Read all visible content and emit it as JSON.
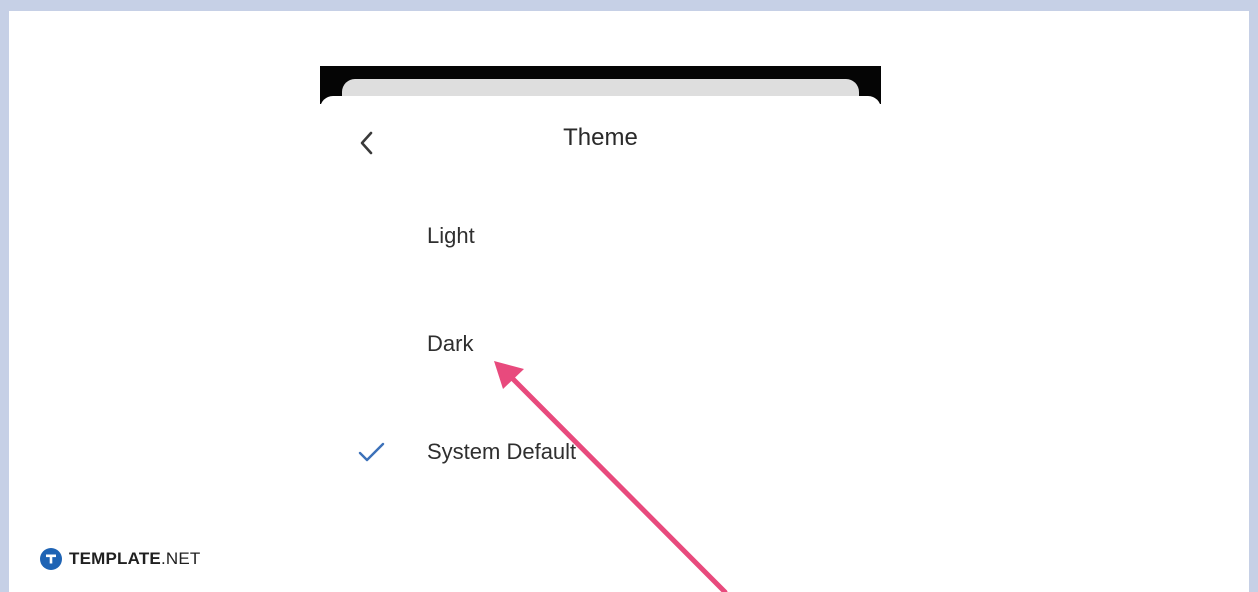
{
  "header": {
    "title": "Theme",
    "back_icon": "chevron-left-icon"
  },
  "options": [
    {
      "label": "Light",
      "selected": false
    },
    {
      "label": "Dark",
      "selected": false
    },
    {
      "label": "System Default",
      "selected": true
    }
  ],
  "watermark": {
    "brand_bold": "TEMPLATE",
    "brand_suffix": ".NET"
  },
  "colors": {
    "frame": "#c6d0e6",
    "check": "#3c71b9",
    "annotation_arrow": "#e84a7d",
    "brand_logo": "#1e63b4"
  },
  "annotation": {
    "type": "arrow",
    "points_to": "Dark"
  }
}
